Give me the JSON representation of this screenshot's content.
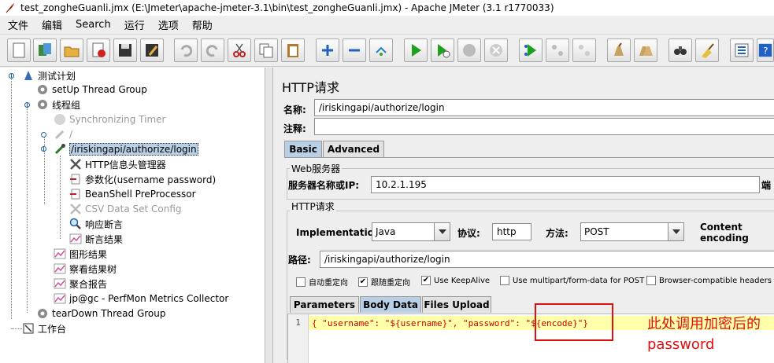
{
  "window": {
    "title": "test_zongheGuanli.jmx (E:\\Jmeter\\apache-jmeter-3.1\\bin\\test_zongheGuanli.jmx) - Apache JMeter (3.1 r1770033)"
  },
  "menu": [
    "文件",
    "编辑",
    "Search",
    "运行",
    "选项",
    "帮助"
  ],
  "toolbar_icons": [
    "new-icon",
    "templates-icon",
    "open-icon",
    "close-icon",
    "save-icon",
    "save-as-icon",
    "undo-icon",
    "redo-icon",
    "cut-icon",
    "copy-icon",
    "paste-icon",
    "expand-icon",
    "collapse-icon",
    "toggle-icon",
    "start-icon",
    "start-no-pause-icon",
    "stop-icon",
    "shutdown-icon",
    "remote-start-icon",
    "remote-stop-icon",
    "remote-shutdown-icon",
    "clear-icon",
    "clear-all-icon",
    "search-icon",
    "reset-search-icon",
    "function-helper-icon",
    "help-icon"
  ],
  "tree": {
    "test_plan": "测试计划",
    "setup_group": "setUp Thread Group",
    "thread_group": "线程组",
    "sync_timer": "Synchronizing Timer",
    "slash_sampler": "/",
    "login_sampler": "/iriskingapi/authorize/login",
    "header_manager": "HTTP信息头管理器",
    "param_item": "参数化(username password)",
    "beanshell": "BeanShell PreProcessor",
    "csv": "CSV Data Set Config",
    "response_assert": "响应断言",
    "assert_result": "断言结果",
    "graph_result": "图形结果",
    "view_tree": "察看结果树",
    "aggregate": "聚合报告",
    "perfmon": "jp@gc - PerfMon Metrics Collector",
    "teardown": "tearDown Thread Group",
    "workbench": "工作台"
  },
  "panel": {
    "title": "HTTP请求",
    "name_label": "名称:",
    "name_value": "/iriskingapi/authorize/login",
    "comment_label": "注释:",
    "comment_value": "",
    "tabs": [
      "Basic",
      "Advanced"
    ],
    "web_server_label": "Web服务器",
    "server_label": "服务器名称或IP:",
    "server_value": "10.2.1.195",
    "port_label": "端",
    "http_request_label": "HTTP请求",
    "impl_label": "Implementation:",
    "impl_value": "Java",
    "protocol_label": "协议:",
    "protocol_value": "http",
    "method_label": "方法:",
    "method_value": "POST",
    "encoding_label": "Content encoding",
    "path_label": "路径:",
    "path_value": "/iriskingapi/authorize/login",
    "checkboxes": [
      {
        "label": "自动重定向",
        "checked": false
      },
      {
        "label": "跟随重定向",
        "checked": true
      },
      {
        "label": "Use KeepAlive",
        "checked": true
      },
      {
        "label": "Use multipart/form-data for POST",
        "checked": false
      },
      {
        "label": "Browser-compatible headers",
        "checked": false
      }
    ],
    "body_tabs": [
      "Parameters",
      "Body Data",
      "Files Upload"
    ],
    "line_number": "1",
    "body_code": "{ \"username\": \"${username}\", \"password\": \"${encode}\"}"
  },
  "annotation": "此处调用加密后的password",
  "colors": {
    "selection": "#b8cfe5",
    "annotation_red": "#e01010",
    "code_red": "#c80000",
    "code_highlight": "#ffffaa"
  }
}
